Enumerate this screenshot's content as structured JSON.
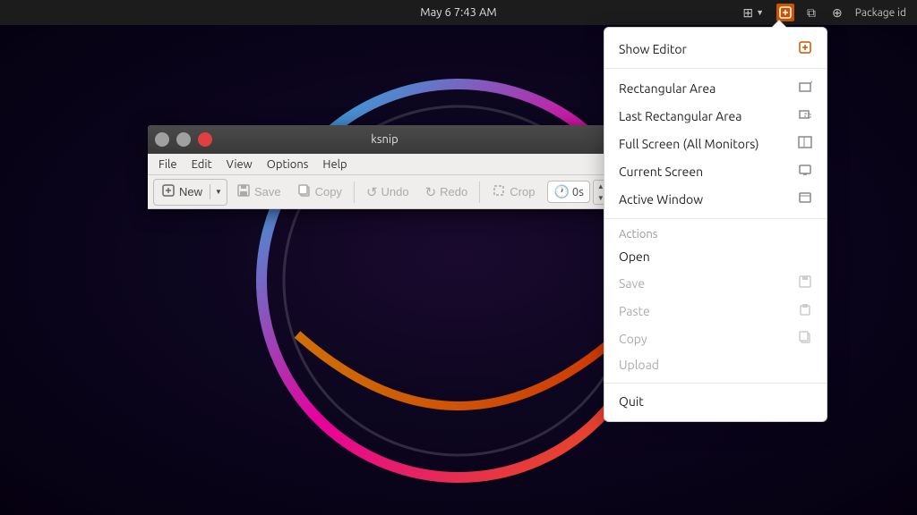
{
  "taskbar": {
    "clock": "May 6  7:43 AM",
    "package_id": "Package id",
    "icons": [
      "grid-icon",
      "ksnip-icon",
      "window-icon",
      "puzzle-icon"
    ]
  },
  "ksnip_window": {
    "title": "ksnip",
    "menu": {
      "items": [
        "File",
        "Edit",
        "View",
        "Options",
        "Help"
      ]
    },
    "toolbar": {
      "new_label": "New",
      "save_label": "Save",
      "copy_label": "Copy",
      "undo_label": "Undo",
      "redo_label": "Redo",
      "crop_label": "Crop",
      "timer_value": "0s"
    }
  },
  "tray_menu": {
    "show_editor_label": "Show Editor",
    "capture_section": {
      "rectangular_area": "Rectangular Area",
      "last_rectangular_area": "Last Rectangular Area",
      "full_screen": "Full Screen (All Monitors)",
      "current_screen": "Current Screen",
      "active_window": "Active Window"
    },
    "actions_label": "Actions",
    "actions": {
      "open": "Open",
      "save": "Save",
      "paste": "Paste",
      "copy": "Copy",
      "upload": "Upload"
    },
    "quit_label": "Quit"
  }
}
